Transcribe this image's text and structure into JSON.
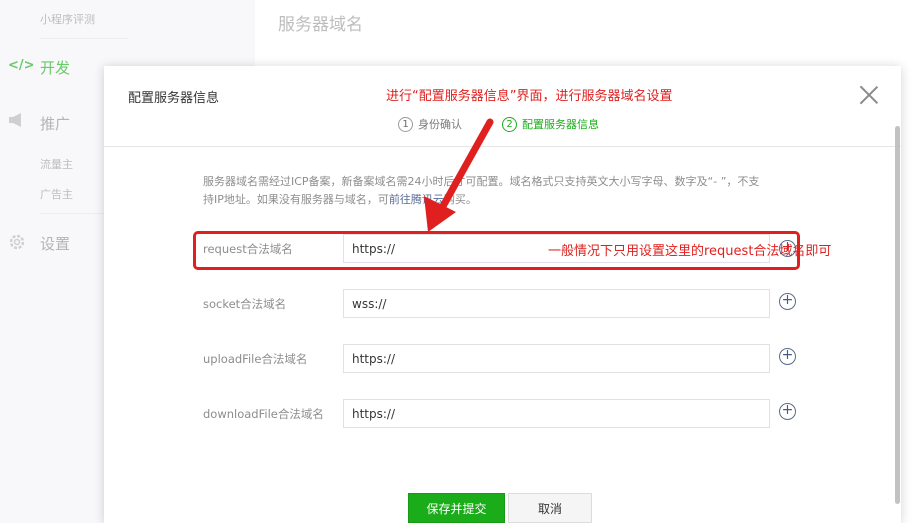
{
  "sidebar": {
    "top_sub": "小程序评测",
    "develop": {
      "icon": "</>",
      "label": "开发"
    },
    "promote": {
      "icon": "megaphone-icon",
      "label": "推广"
    },
    "promote_items": [
      "流量主",
      "广告主"
    ],
    "settings": {
      "icon": "gear-icon",
      "label": "设置"
    }
  },
  "page": {
    "title": "服务器域名"
  },
  "modal": {
    "title": "配置服务器信息",
    "steps": [
      {
        "num": "1",
        "label": "身份确认"
      },
      {
        "num": "2",
        "label": "配置服务器信息"
      }
    ],
    "description_1": "服务器域名需经过ICP备案，新备案域名需24小时后才可配置。域名格式只支持英文大小写字母、数字及“- ”，不支",
    "description_2": "持IP地址。如果没有服务器与域名，可",
    "description_link": "前往腾讯云",
    "description_3": "购买。",
    "fields": [
      {
        "label": "request合法域名",
        "value": "https://"
      },
      {
        "label": "socket合法域名",
        "value": "wss://"
      },
      {
        "label": "uploadFile合法域名",
        "value": "https://"
      },
      {
        "label": "downloadFile合法域名",
        "value": "https://"
      }
    ],
    "submit_label": "保存并提交",
    "cancel_label": "取消"
  },
  "annotations": {
    "top_note": "进行“配置服务器信息”界面，进行服务器域名设置",
    "field_note": "一般情况下只用设置这里的request合法域名即可",
    "color": "#e0201f"
  },
  "colors": {
    "accent": "#1aad19",
    "link": "#576b95"
  }
}
